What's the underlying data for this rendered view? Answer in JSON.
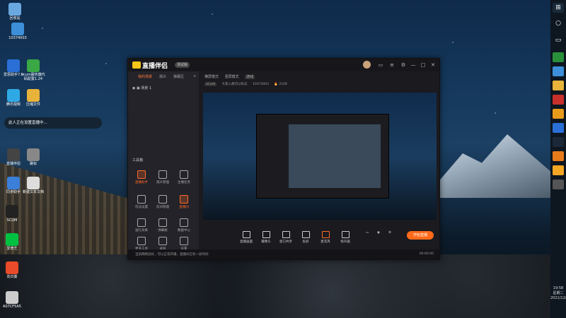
{
  "desktop": {
    "icons": [
      {
        "label": "回收站",
        "color": "#6aa9e0"
      },
      {
        "label": "10374003",
        "color": "#3c8fd8"
      },
      {
        "label": "爱思助手7.0",
        "color": "#2a6fd6"
      },
      {
        "label": "scum服务器代码配置1.24",
        "color": "#39a845"
      },
      {
        "label": "腾讯视频",
        "color": "#2fa9e5"
      },
      {
        "label": "压缩文件",
        "color": "#e8b33a"
      },
      {
        "label": "直播伴侣",
        "color": "#444444"
      },
      {
        "label": "路标",
        "color": "#888888"
      },
      {
        "label": "同步助手",
        "color": "#3c7fd8"
      },
      {
        "label": "新建文本文档",
        "color": "#dddddd"
      },
      {
        "label": "SCUM",
        "color": "#222222"
      },
      {
        "label": "爱奇艺",
        "color": "#00c040"
      },
      {
        "label": "向日葵",
        "color": "#e84b2a"
      },
      {
        "label": "A07CF5A5",
        "color": "#cccccc"
      }
    ],
    "notice": "此人正在设置直播中..."
  },
  "taskbar": {
    "clock_time": "19:58",
    "clock_day": "星期二",
    "clock_date": "2021/12/7"
  },
  "app": {
    "name": "直播伴侣",
    "version_badge": "测试版",
    "sidebar_tabs": [
      "我的场景",
      "观众",
      "弹幕区"
    ],
    "scene_label": "场景 1",
    "toolbox_title": "工具箱",
    "tools": [
      {
        "label": "直播助手",
        "highlight": true
      },
      {
        "label": "观众管理",
        "highlight": false
      },
      {
        "label": "主播任务",
        "highlight": false
      },
      {
        "label": "玩法设置",
        "highlight": false
      },
      {
        "label": "房间管理",
        "highlight": false
      },
      {
        "label": "直播间",
        "highlight": true
      },
      {
        "label": "送礼效果",
        "highlight": false
      },
      {
        "label": "弹幕姬",
        "highlight": false
      },
      {
        "label": "数据中心",
        "highlight": false
      },
      {
        "label": "更多工具",
        "highlight": false
      },
      {
        "label": "录屏",
        "highlight": false
      },
      {
        "label": "设置",
        "highlight": false
      }
    ],
    "main_tabs": [
      "横屏模式",
      "竖屏模式",
      "游戏"
    ],
    "info": {
      "game": "SCUM",
      "room_title": "大家入群可以私信",
      "room_id": "10374003",
      "viewers": "2108"
    },
    "controls": [
      "直播画面",
      "摄像头",
      "窗口共享",
      "投屏",
      "麦克风",
      "扬声器"
    ],
    "go_live": "开始直播",
    "status_text": "当前网络良好，可以正常开播，直播间已有一段时间",
    "status_right": "00:00:00"
  }
}
